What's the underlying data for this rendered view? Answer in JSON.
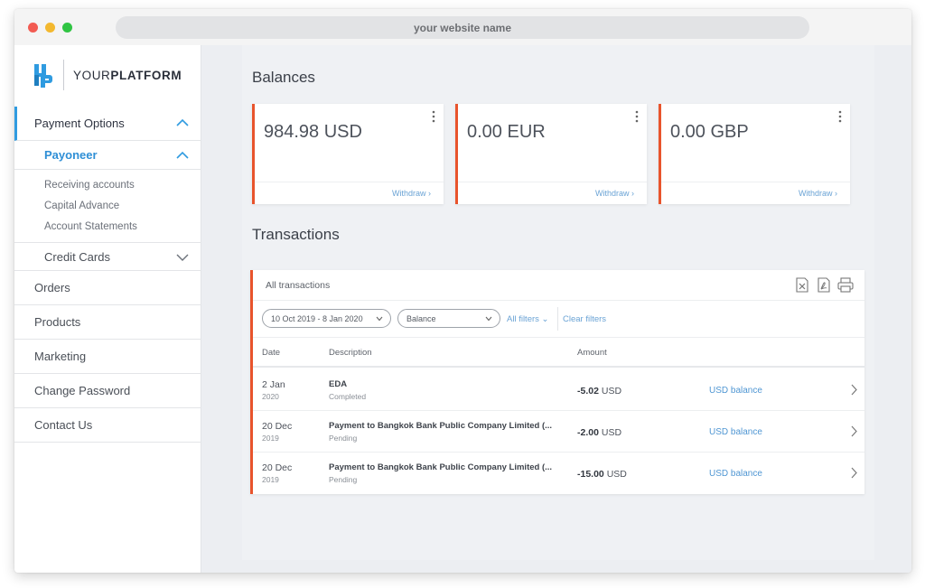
{
  "browser": {
    "url_text": "your website name"
  },
  "logo": {
    "light": "YOUR",
    "bold": "PLATFORM"
  },
  "sidebar": {
    "payment_options": "Payment Options",
    "payoneer": "Payoneer",
    "payoneer_items": [
      "Receiving accounts",
      "Capital Advance",
      "Account Statements"
    ],
    "credit_cards": "Credit Cards",
    "items": [
      "Orders",
      "Products",
      "Marketing",
      "Change Password",
      "Contact Us"
    ]
  },
  "balances": {
    "title": "Balances",
    "cards": [
      {
        "amount": "984.98 USD",
        "action": "Withdraw"
      },
      {
        "amount": "0.00 EUR",
        "action": "Withdraw"
      },
      {
        "amount": "0.00 GBP",
        "action": "Withdraw"
      }
    ]
  },
  "transactions": {
    "title": "Transactions",
    "header_label": "All transactions",
    "icons": [
      "excel-export-icon",
      "pdf-export-icon",
      "print-icon"
    ],
    "filters": {
      "date_range": "10 Oct 2019 - 8 Jan 2020",
      "balance": "Balance",
      "all_filters": "All filters",
      "clear_filters": "Clear filters"
    },
    "columns": {
      "date": "Date",
      "description": "Description",
      "amount": "Amount"
    },
    "rows": [
      {
        "date": "2 Jan",
        "year": "2020",
        "description": "EDA",
        "status": "Completed",
        "amount": "-5.02",
        "currency": "USD",
        "balance": "USD balance"
      },
      {
        "date": "20 Dec",
        "year": "2019",
        "description": "Payment to Bangkok Bank Public Company Limited (...",
        "status": "Pending",
        "amount": "-2.00",
        "currency": "USD",
        "balance": "USD balance"
      },
      {
        "date": "20 Dec",
        "year": "2019",
        "description": "Payment to Bangkok Bank Public Company Limited (...",
        "status": "Pending",
        "amount": "-15.00",
        "currency": "USD",
        "balance": "USD balance"
      }
    ]
  },
  "colors": {
    "accent": "#e8542c",
    "link": "#4f96d3",
    "active_nav": "#2f9be0"
  }
}
